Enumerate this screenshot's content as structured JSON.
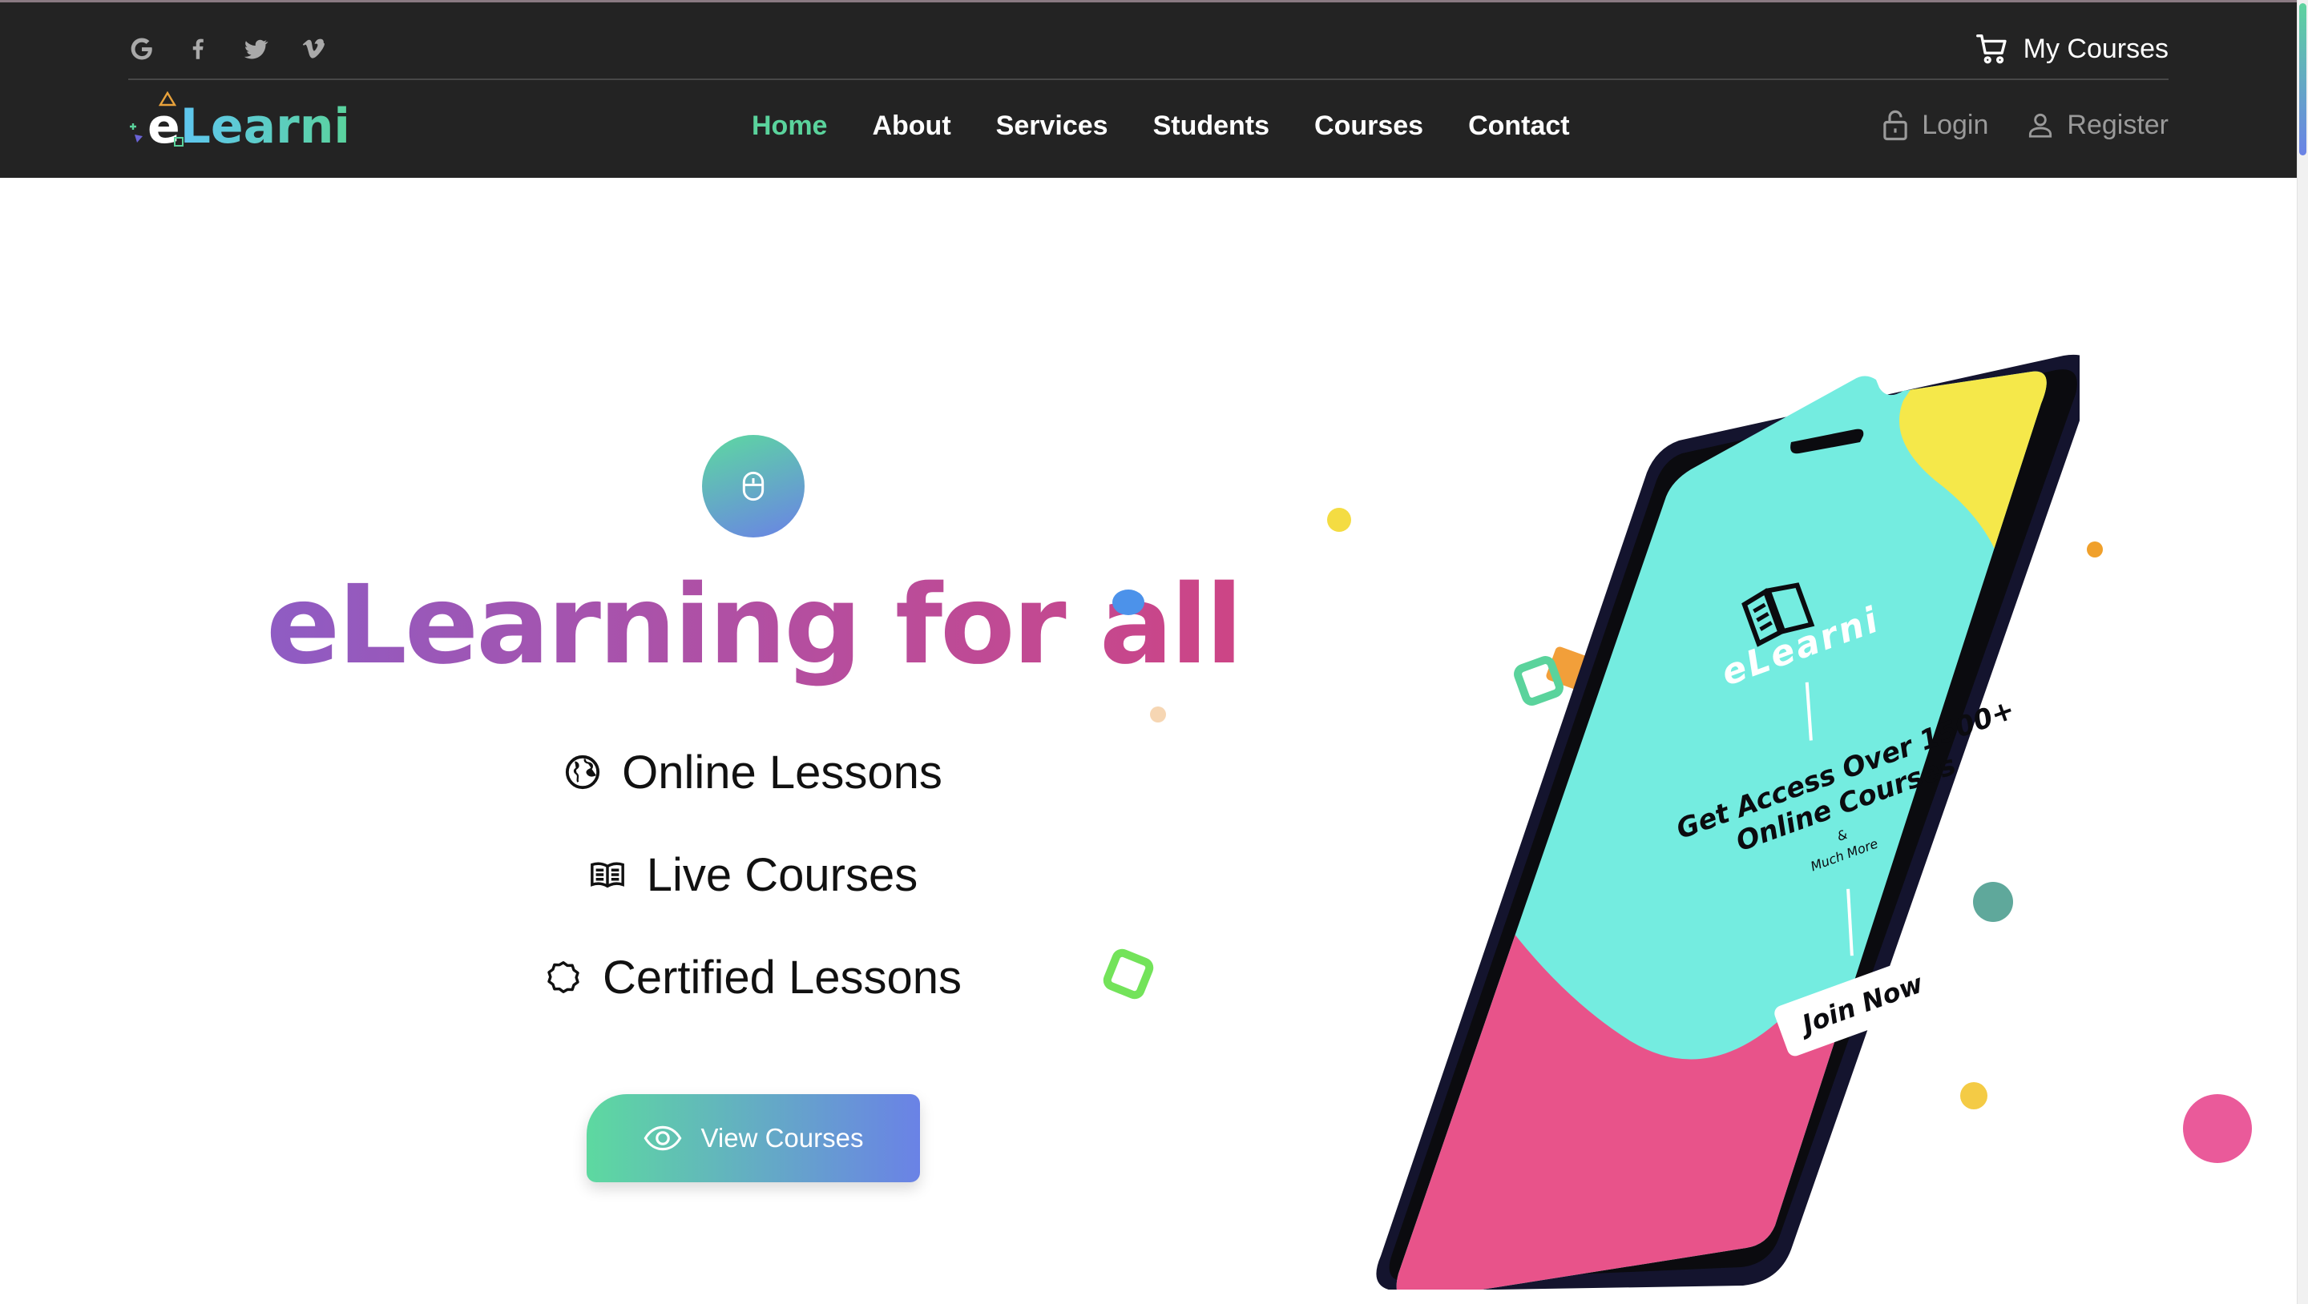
{
  "header": {
    "social": [
      {
        "name": "google-icon",
        "glyph": "G"
      },
      {
        "name": "facebook-icon"
      },
      {
        "name": "twitter-icon"
      },
      {
        "name": "vimeo-icon"
      }
    ],
    "my_courses_label": "My Courses",
    "logo": {
      "e": "e",
      "rest": "Learni"
    },
    "nav": [
      {
        "label": "Home",
        "active": true
      },
      {
        "label": "About",
        "active": false
      },
      {
        "label": "Services",
        "active": false
      },
      {
        "label": "Students",
        "active": false
      },
      {
        "label": "Courses",
        "active": false
      },
      {
        "label": "Contact",
        "active": false
      }
    ],
    "login_label": "Login",
    "register_label": "Register"
  },
  "hero": {
    "title": "eLearning for all",
    "features": {
      "online": "Online Lessons",
      "live": "Live Courses",
      "certified": "Certified Lessons"
    },
    "cta_label": "View Courses"
  },
  "phone_screen": {
    "brand": "eLearni",
    "headline_1": "Get Access Over 1500+",
    "headline_2": "Online Courses",
    "amp": "&",
    "sub": "Much More",
    "join": "Join Now"
  },
  "colors": {
    "header_bg": "#232323",
    "accent_green": "#5ad39c",
    "accent_blue": "#6a82e6",
    "title_gradient": [
      "#7b63d6",
      "#b24fa2",
      "#dc3f76"
    ],
    "screen_bg": "#74ece0",
    "screen_pink": "#e8538a",
    "screen_yellow": "#f5e84a"
  }
}
